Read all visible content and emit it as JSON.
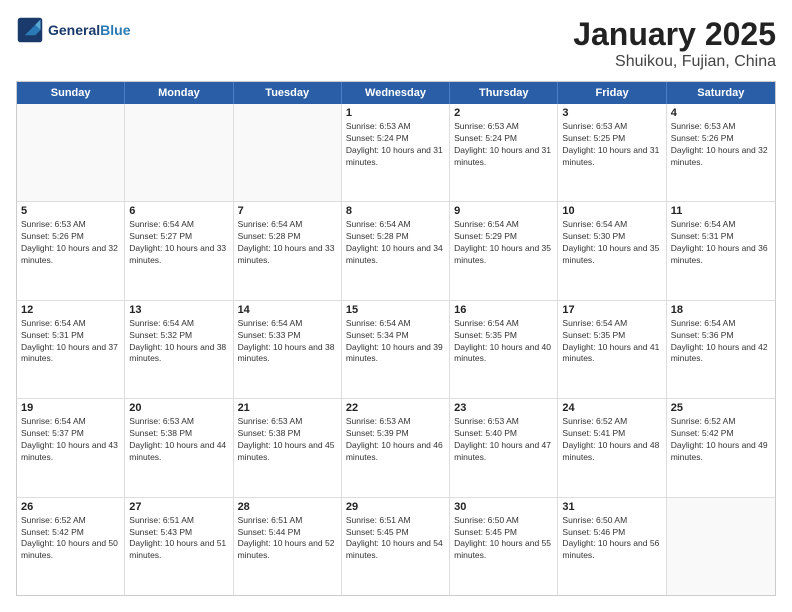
{
  "logo": {
    "text_general": "General",
    "text_blue": "Blue"
  },
  "title": "January 2025",
  "subtitle": "Shuikou, Fujian, China",
  "header_days": [
    "Sunday",
    "Monday",
    "Tuesday",
    "Wednesday",
    "Thursday",
    "Friday",
    "Saturday"
  ],
  "weeks": [
    [
      {
        "day": "",
        "empty": true
      },
      {
        "day": "",
        "empty": true
      },
      {
        "day": "",
        "empty": true
      },
      {
        "day": "1",
        "sunrise": "6:53 AM",
        "sunset": "5:24 PM",
        "daylight": "10 hours and 31 minutes."
      },
      {
        "day": "2",
        "sunrise": "6:53 AM",
        "sunset": "5:24 PM",
        "daylight": "10 hours and 31 minutes."
      },
      {
        "day": "3",
        "sunrise": "6:53 AM",
        "sunset": "5:25 PM",
        "daylight": "10 hours and 31 minutes."
      },
      {
        "day": "4",
        "sunrise": "6:53 AM",
        "sunset": "5:26 PM",
        "daylight": "10 hours and 32 minutes."
      }
    ],
    [
      {
        "day": "5",
        "sunrise": "6:53 AM",
        "sunset": "5:26 PM",
        "daylight": "10 hours and 32 minutes."
      },
      {
        "day": "6",
        "sunrise": "6:54 AM",
        "sunset": "5:27 PM",
        "daylight": "10 hours and 33 minutes."
      },
      {
        "day": "7",
        "sunrise": "6:54 AM",
        "sunset": "5:28 PM",
        "daylight": "10 hours and 33 minutes."
      },
      {
        "day": "8",
        "sunrise": "6:54 AM",
        "sunset": "5:28 PM",
        "daylight": "10 hours and 34 minutes."
      },
      {
        "day": "9",
        "sunrise": "6:54 AM",
        "sunset": "5:29 PM",
        "daylight": "10 hours and 35 minutes."
      },
      {
        "day": "10",
        "sunrise": "6:54 AM",
        "sunset": "5:30 PM",
        "daylight": "10 hours and 35 minutes."
      },
      {
        "day": "11",
        "sunrise": "6:54 AM",
        "sunset": "5:31 PM",
        "daylight": "10 hours and 36 minutes."
      }
    ],
    [
      {
        "day": "12",
        "sunrise": "6:54 AM",
        "sunset": "5:31 PM",
        "daylight": "10 hours and 37 minutes."
      },
      {
        "day": "13",
        "sunrise": "6:54 AM",
        "sunset": "5:32 PM",
        "daylight": "10 hours and 38 minutes."
      },
      {
        "day": "14",
        "sunrise": "6:54 AM",
        "sunset": "5:33 PM",
        "daylight": "10 hours and 38 minutes."
      },
      {
        "day": "15",
        "sunrise": "6:54 AM",
        "sunset": "5:34 PM",
        "daylight": "10 hours and 39 minutes."
      },
      {
        "day": "16",
        "sunrise": "6:54 AM",
        "sunset": "5:35 PM",
        "daylight": "10 hours and 40 minutes."
      },
      {
        "day": "17",
        "sunrise": "6:54 AM",
        "sunset": "5:35 PM",
        "daylight": "10 hours and 41 minutes."
      },
      {
        "day": "18",
        "sunrise": "6:54 AM",
        "sunset": "5:36 PM",
        "daylight": "10 hours and 42 minutes."
      }
    ],
    [
      {
        "day": "19",
        "sunrise": "6:54 AM",
        "sunset": "5:37 PM",
        "daylight": "10 hours and 43 minutes."
      },
      {
        "day": "20",
        "sunrise": "6:53 AM",
        "sunset": "5:38 PM",
        "daylight": "10 hours and 44 minutes."
      },
      {
        "day": "21",
        "sunrise": "6:53 AM",
        "sunset": "5:38 PM",
        "daylight": "10 hours and 45 minutes."
      },
      {
        "day": "22",
        "sunrise": "6:53 AM",
        "sunset": "5:39 PM",
        "daylight": "10 hours and 46 minutes."
      },
      {
        "day": "23",
        "sunrise": "6:53 AM",
        "sunset": "5:40 PM",
        "daylight": "10 hours and 47 minutes."
      },
      {
        "day": "24",
        "sunrise": "6:52 AM",
        "sunset": "5:41 PM",
        "daylight": "10 hours and 48 minutes."
      },
      {
        "day": "25",
        "sunrise": "6:52 AM",
        "sunset": "5:42 PM",
        "daylight": "10 hours and 49 minutes."
      }
    ],
    [
      {
        "day": "26",
        "sunrise": "6:52 AM",
        "sunset": "5:42 PM",
        "daylight": "10 hours and 50 minutes."
      },
      {
        "day": "27",
        "sunrise": "6:51 AM",
        "sunset": "5:43 PM",
        "daylight": "10 hours and 51 minutes."
      },
      {
        "day": "28",
        "sunrise": "6:51 AM",
        "sunset": "5:44 PM",
        "daylight": "10 hours and 52 minutes."
      },
      {
        "day": "29",
        "sunrise": "6:51 AM",
        "sunset": "5:45 PM",
        "daylight": "10 hours and 54 minutes."
      },
      {
        "day": "30",
        "sunrise": "6:50 AM",
        "sunset": "5:45 PM",
        "daylight": "10 hours and 55 minutes."
      },
      {
        "day": "31",
        "sunrise": "6:50 AM",
        "sunset": "5:46 PM",
        "daylight": "10 hours and 56 minutes."
      },
      {
        "day": "",
        "empty": true
      }
    ]
  ]
}
